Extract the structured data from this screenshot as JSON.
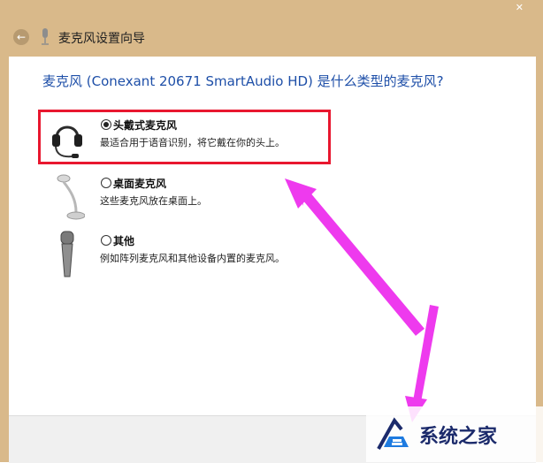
{
  "window": {
    "title": "麦克风设置向导",
    "close_glyph": "✕"
  },
  "question": "麦克风 (Conexant 20671 SmartAudio HD) 是什么类型的麦克风?",
  "options": [
    {
      "label": "头戴式麦克风",
      "description": "最适合用于语音识别，将它戴在你的头上。",
      "selected": true,
      "icon": "headset-icon"
    },
    {
      "label": "桌面麦克风",
      "description": "这些麦克风放在桌面上。",
      "selected": false,
      "icon": "desktop-mic-icon"
    },
    {
      "label": "其他",
      "description": "例如阵列麦克风和其他设备内置的麦克风。",
      "selected": false,
      "icon": "handheld-mic-icon"
    }
  ],
  "annotations": {
    "highlight_color": "#e8172f",
    "arrow_color": "#ee3aee"
  },
  "watermark": {
    "text": "系统之家"
  }
}
